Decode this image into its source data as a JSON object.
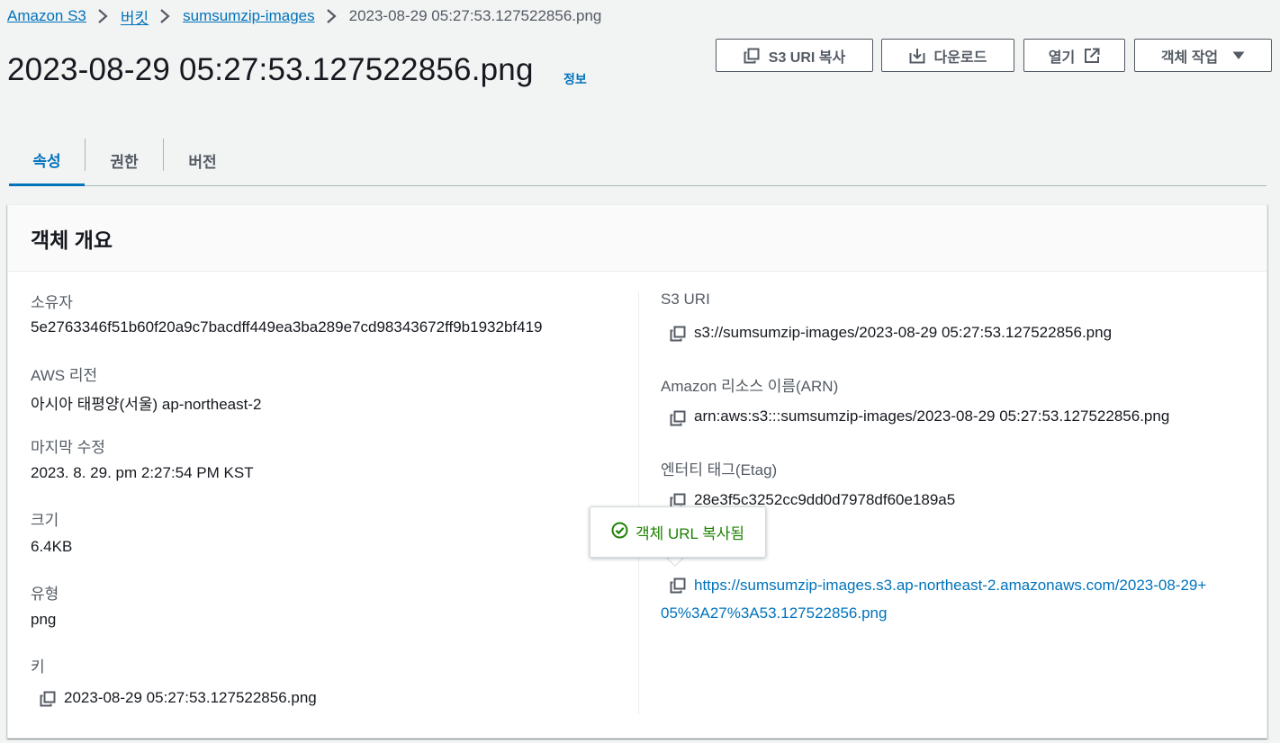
{
  "breadcrumb": {
    "items": [
      "Amazon S3",
      "버킷",
      "sumsumzip-images"
    ],
    "current": "2023-08-29 05:27:53.127522856.png"
  },
  "header": {
    "title": "2023-08-29 05:27:53.127522856.png",
    "info_label": "정보"
  },
  "actions": {
    "copy_uri": "S3 URI 복사",
    "download": "다운로드",
    "open": "열기",
    "object_actions": "객체 작업"
  },
  "tabs": [
    {
      "label": "속성",
      "active": true
    },
    {
      "label": "권한",
      "active": false
    },
    {
      "label": "버전",
      "active": false
    }
  ],
  "overview": {
    "title": "객체 개요",
    "owner_label": "소유자",
    "owner_value": "5e2763346f51b60f20a9c7bacdff449ea3ba289e7cd98343672ff9b1932bf419",
    "region_label": "AWS 리전",
    "region_value": "아시아 태평양(서울) ap-northeast-2",
    "modified_label": "마지막 수정",
    "modified_value": "2023. 8. 29. pm 2:27:54 PM KST",
    "size_label": "크기",
    "size_value": "6.4KB",
    "type_label": "유형",
    "type_value": "png",
    "key_label": "키",
    "key_value": "2023-08-29 05:27:53.127522856.png",
    "s3uri_label": "S3 URI",
    "s3uri_value": "s3://sumsumzip-images/2023-08-29 05:27:53.127522856.png",
    "arn_label": "Amazon 리소스 이름(ARN)",
    "arn_value": "arn:aws:s3:::sumsumzip-images/2023-08-29 05:27:53.127522856.png",
    "etag_label": "엔터티 태그(Etag)",
    "etag_value": "28e3f5c3252cc9dd0d7978df60e189a5",
    "url_line1": "https://sumsumzip-images.s3.ap-northeast-2.amazonaws.com/2023-08-29+",
    "url_line2": "05%3A27%3A53.127522856.png"
  },
  "tooltip": {
    "text": "객체 URL 복사됨"
  },
  "colors": {
    "link": "#0073bb",
    "success": "#1d8102",
    "text": "#16191f",
    "muted": "#545b64"
  }
}
